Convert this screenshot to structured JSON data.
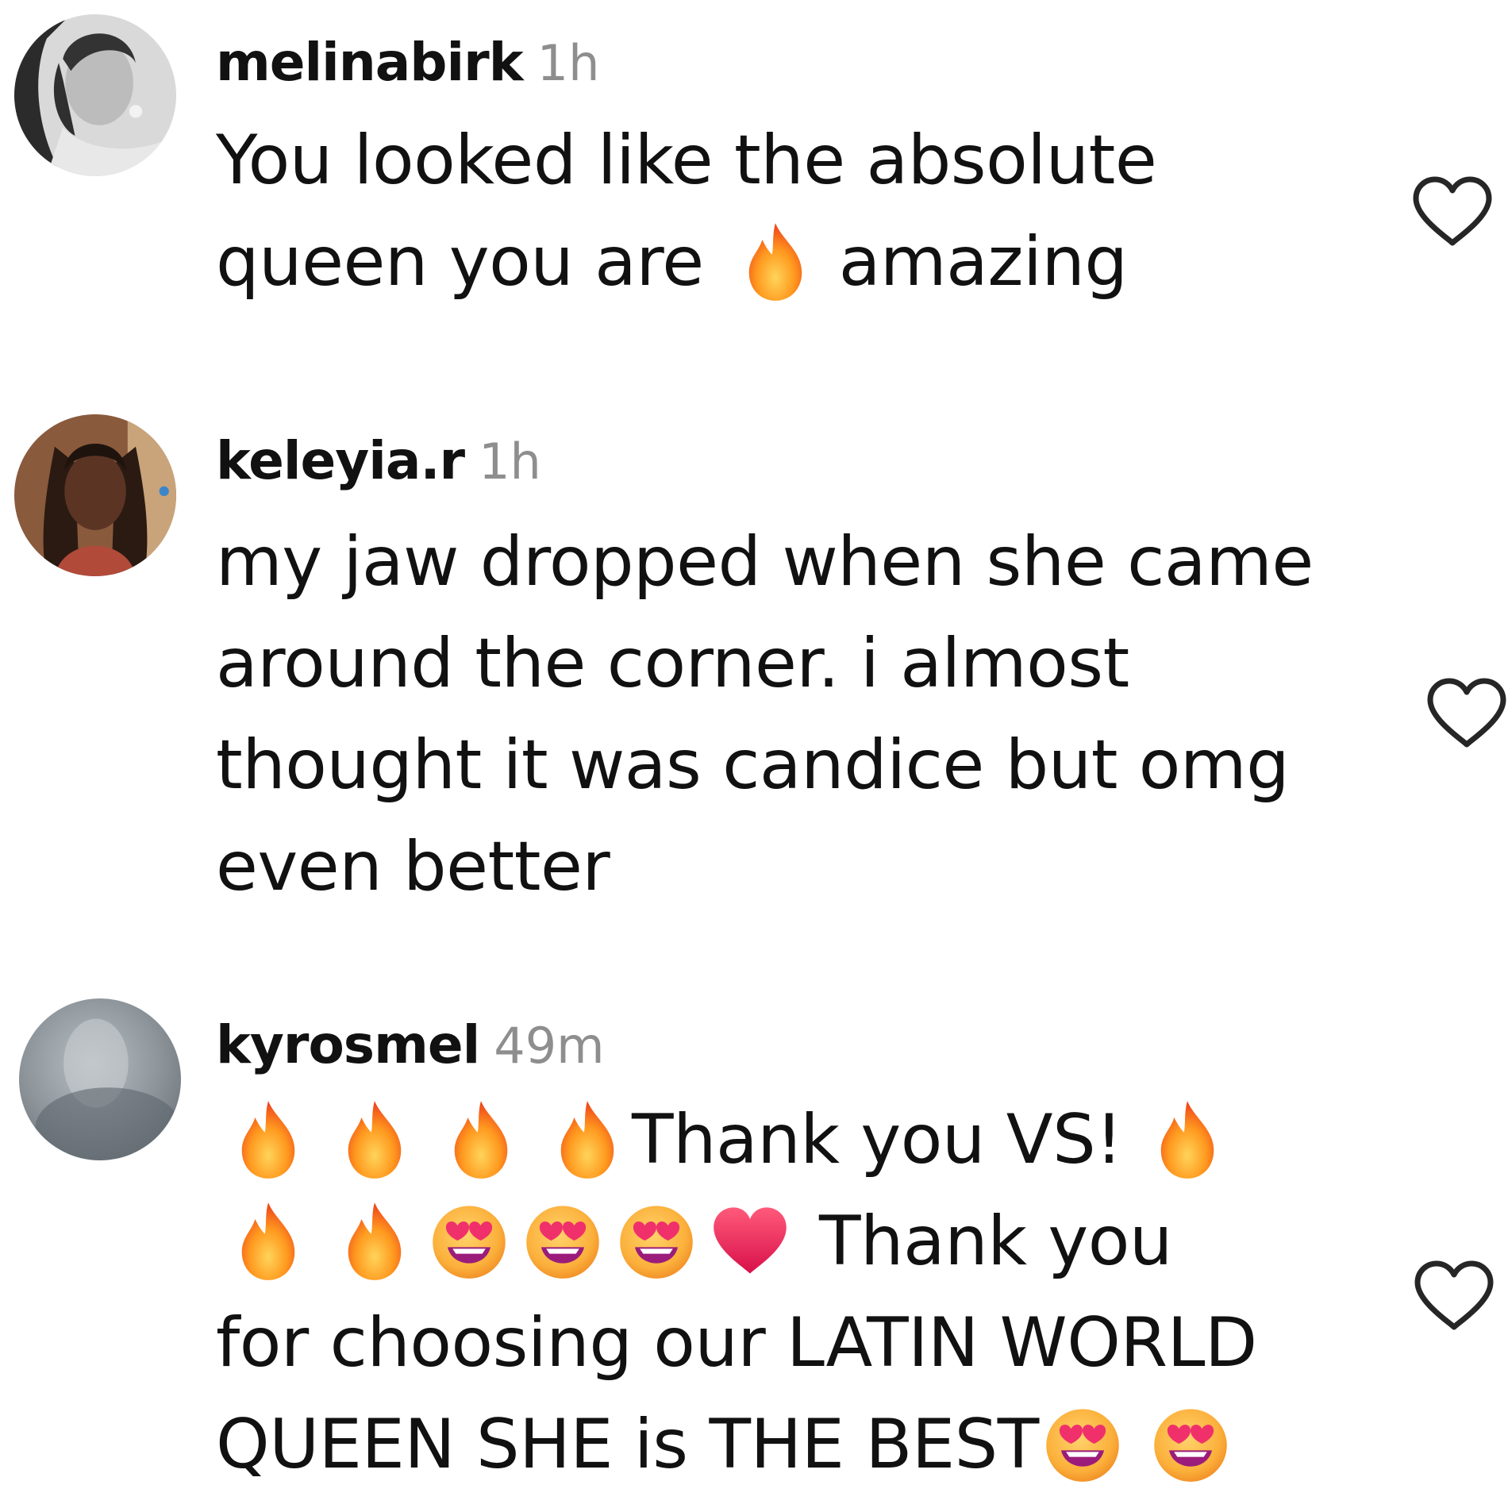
{
  "comments": [
    {
      "username": "melinabirk",
      "time": "1h",
      "avatar": "woman-portrait-grayscale",
      "lines": [
        "You looked like the absolute",
        "queen you are",
        "amazing"
      ]
    },
    {
      "username": "keleyia.r",
      "time": "1h",
      "avatar": "woman-portrait-color",
      "lines": [
        "my jaw dropped when she came",
        "around the corner. i almost",
        "thought it was candice but omg",
        "even better"
      ]
    },
    {
      "username": "kyrosmel",
      "time": "49m",
      "avatar": "blurred-gray-photo",
      "lines": [
        "Thank you VS!",
        "Thank you",
        "for choosing our LATIN WORLD",
        "QUEEN SHE is THE BEST"
      ]
    }
  ],
  "icons": {
    "like": "heart-outline-icon",
    "fire": "fire-emoji",
    "heart_eyes": "smiling-face-with-heart-eyes-emoji",
    "red_heart": "red-heart-emoji"
  },
  "colors": {
    "username": "#111111",
    "time": "#8e8e8e",
    "like_icon": "#262626",
    "background": "#ffffff"
  }
}
